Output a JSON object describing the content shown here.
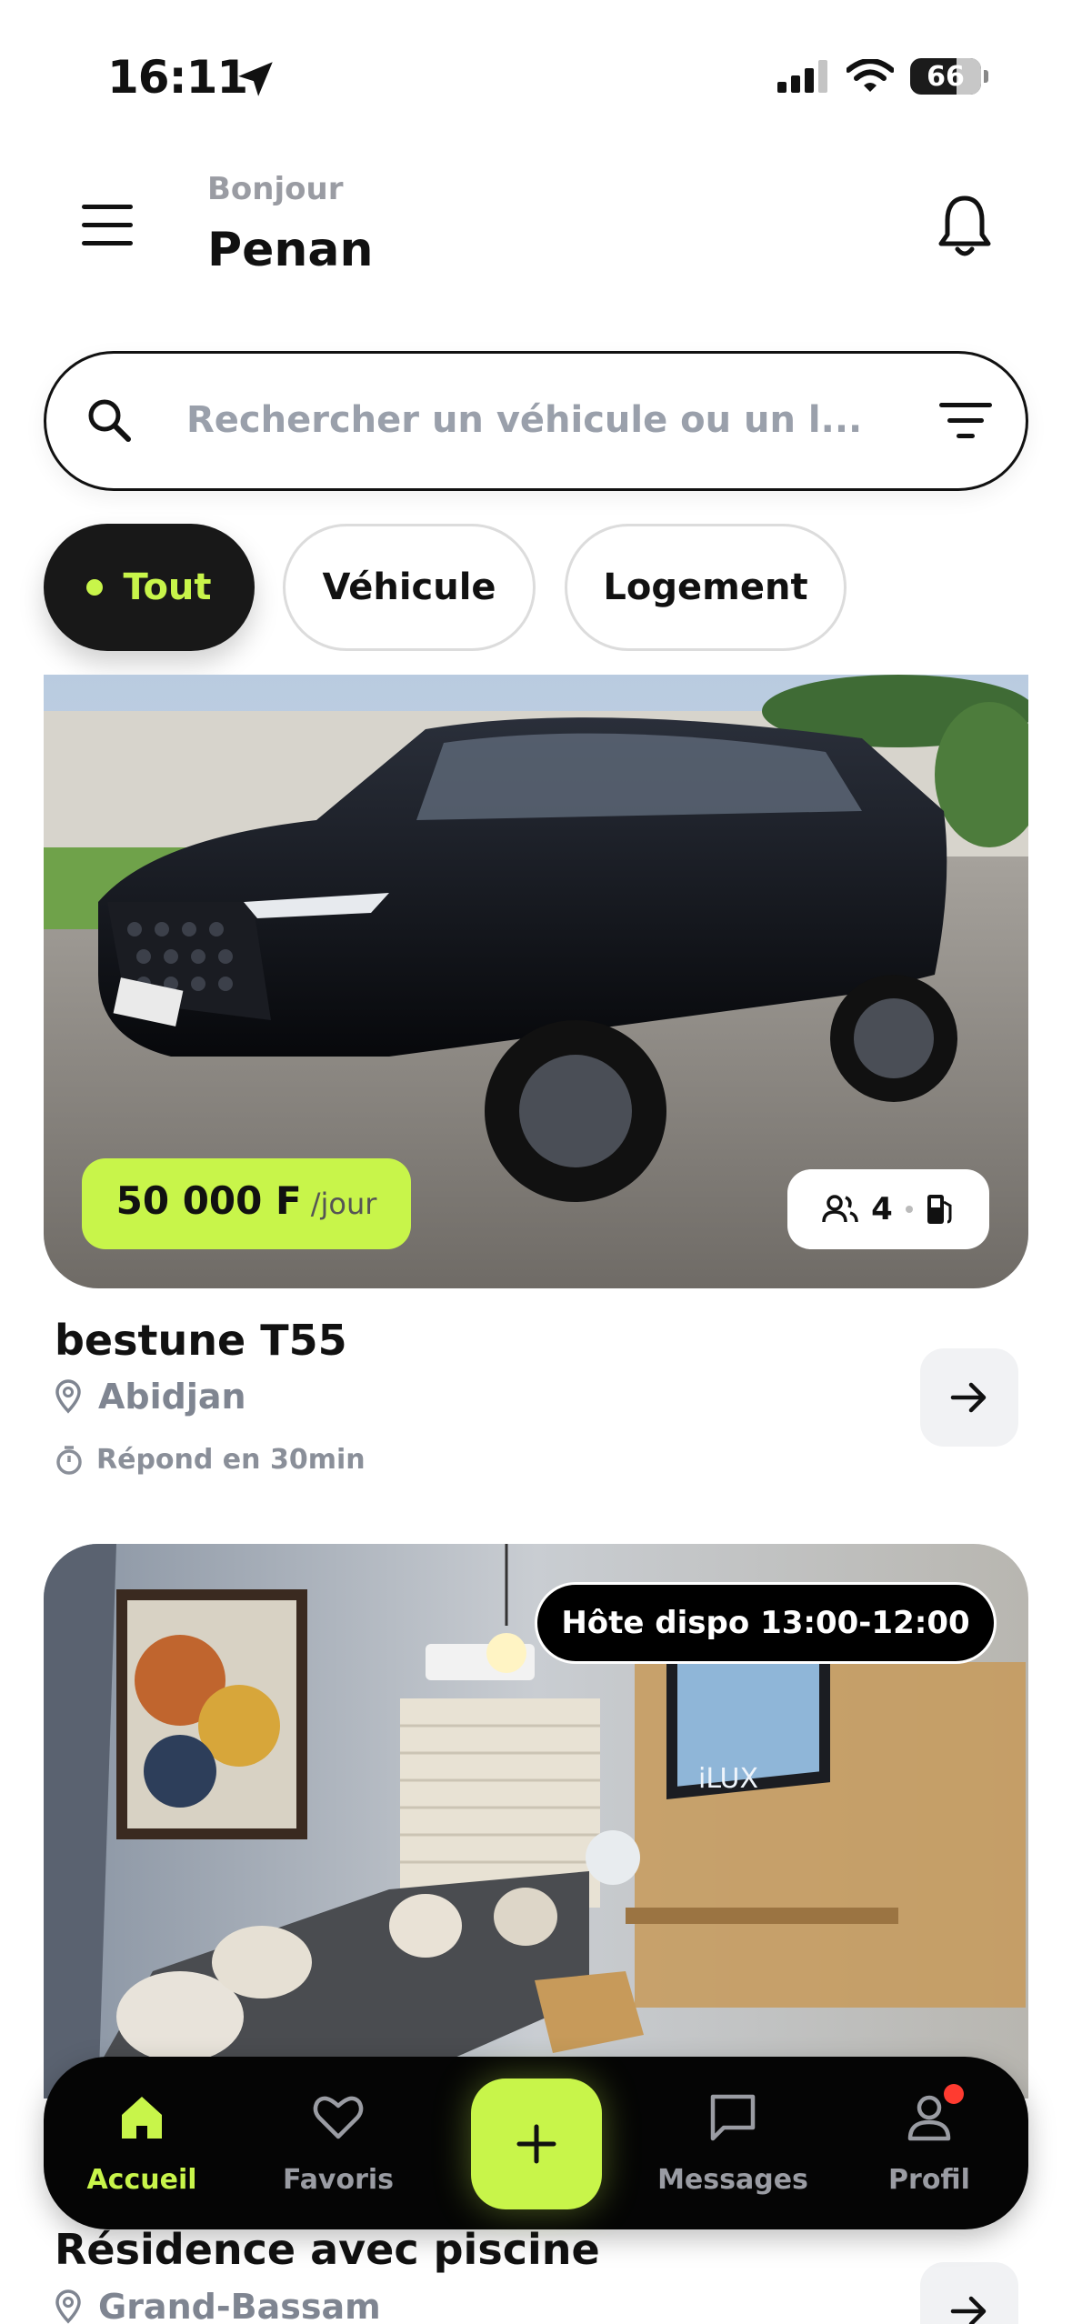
{
  "status_bar": {
    "time": "16:11",
    "battery": "66"
  },
  "header": {
    "greeting": "Bonjour",
    "user_name": "Penan"
  },
  "search": {
    "placeholder": "Rechercher un véhicule ou un l..."
  },
  "filters": {
    "all": "Tout",
    "vehicle": "Véhicule",
    "home": "Logement"
  },
  "listings": [
    {
      "price": "50 000 F",
      "price_unit": "/jour",
      "seats": "4",
      "title": "bestune T55",
      "location": "Abidjan",
      "response": "Répond en 30min"
    },
    {
      "host_availability": "Hôte dispo 13:00-12:00",
      "title": "Résidence avec piscine",
      "location": "Grand-Bassam"
    }
  ],
  "nav": {
    "home": "Accueil",
    "favorites": "Favoris",
    "messages": "Messages",
    "profile": "Profil"
  },
  "colors": {
    "accent": "#c8f54a",
    "dark": "#111111",
    "muted": "#9a9ca3"
  }
}
